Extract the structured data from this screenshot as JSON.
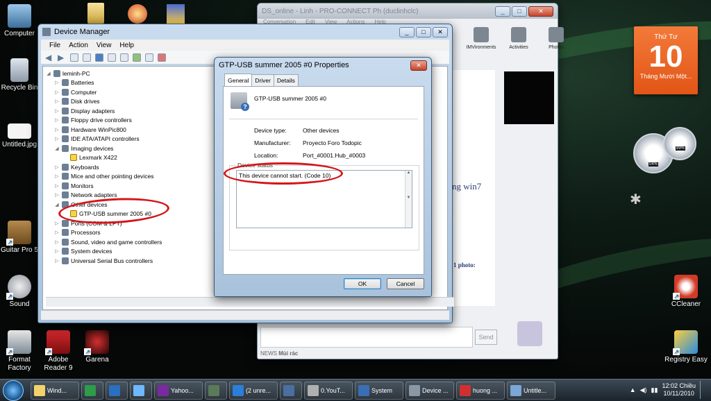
{
  "desktop": {
    "icons": [
      {
        "label": "Computer"
      },
      {
        "label": "Recycle Bin"
      },
      {
        "label": "Untitled.jpg"
      },
      {
        "label": "Guitar Pro 5"
      },
      {
        "label": "Sound"
      },
      {
        "label": "Format Factory"
      },
      {
        "label": "Adobe Reader 9"
      },
      {
        "label": "Garena"
      },
      {
        "label": "CCleaner"
      },
      {
        "label": "Registry Easy"
      }
    ]
  },
  "chat": {
    "title": "DS_online - Linh - PRO-CONNECT Ph (duclinhclc)",
    "menu": [
      "Conversation",
      "Edit",
      "View",
      "Actions",
      "Help"
    ],
    "tools": [
      "IMVironments",
      "Activities",
      "Photos"
    ],
    "fragment_1": "ng win7",
    "fragment_2": "1 photo:",
    "send_label": "Send",
    "news_label": "NEWS",
    "news_text": "Mùi rác"
  },
  "device_manager": {
    "title": "Device Manager",
    "menu": [
      "File",
      "Action",
      "View",
      "Help"
    ],
    "tree": {
      "root": "leminh-PC",
      "nodes": [
        {
          "label": "Batteries",
          "expanded": false
        },
        {
          "label": "Computer",
          "expanded": false
        },
        {
          "label": "Disk drives",
          "expanded": false
        },
        {
          "label": "Display adapters",
          "expanded": false
        },
        {
          "label": "Floppy drive controllers",
          "expanded": false
        },
        {
          "label": "Hardware WinPic800",
          "expanded": false
        },
        {
          "label": "IDE ATA/ATAPI controllers",
          "expanded": false
        },
        {
          "label": "Imaging devices",
          "expanded": true
        },
        {
          "label": "Lexmark X422",
          "child": true,
          "warning": true
        },
        {
          "label": "Keyboards",
          "expanded": false
        },
        {
          "label": "Mice and other pointing devices",
          "expanded": false
        },
        {
          "label": "Monitors",
          "expanded": false
        },
        {
          "label": "Network adapters",
          "expanded": false
        },
        {
          "label": "Other devices",
          "expanded": true
        },
        {
          "label": "GTP-USB summer 2005 #0",
          "child": true,
          "warning": true
        },
        {
          "label": "Ports (COM & LPT)",
          "expanded": false
        },
        {
          "label": "Processors",
          "expanded": false
        },
        {
          "label": "Sound, video and game controllers",
          "expanded": false
        },
        {
          "label": "System devices",
          "expanded": false
        },
        {
          "label": "Universal Serial Bus controllers",
          "expanded": false
        }
      ]
    }
  },
  "properties": {
    "title": "GTP-USB summer 2005 #0 Properties",
    "tabs": [
      "General",
      "Driver",
      "Details"
    ],
    "device_name": "GTP-USB summer 2005 #0",
    "device_type_label": "Device type:",
    "device_type": "Other devices",
    "manufacturer_label": "Manufacturer:",
    "manufacturer": "Proyecto Foro Todopic",
    "location_label": "Location:",
    "location": "Port_#0001.Hub_#0003",
    "status_legend": "Device status",
    "status_text": "This device cannot start. (Code 10)",
    "ok_label": "OK",
    "cancel_label": "Cancel"
  },
  "gadgets": {
    "calendar_day": "Thứ Tư",
    "calendar_date": "10",
    "calendar_month": "Tháng Mười Một...",
    "cpu_percent": "04%",
    "ram_percent": "89%"
  },
  "taskbar": {
    "tasks": [
      {
        "label": "Wind..."
      },
      {
        "label": ""
      },
      {
        "label": ""
      },
      {
        "label": ""
      },
      {
        "label": "Yahoo..."
      },
      {
        "label": ""
      },
      {
        "label": "(2 unre..."
      },
      {
        "label": ""
      },
      {
        "label": "0.YouT..."
      },
      {
        "label": "System"
      },
      {
        "label": "Device ..."
      },
      {
        "label": "huong ..."
      },
      {
        "label": "Untitle..."
      }
    ],
    "clock_time": "12:02 Chiều",
    "clock_date": "10/11/2010"
  },
  "colors": {
    "annotation_red": "#d4161a",
    "calendar_orange": "#e25516",
    "warning_yellow": "#f5d44a"
  }
}
